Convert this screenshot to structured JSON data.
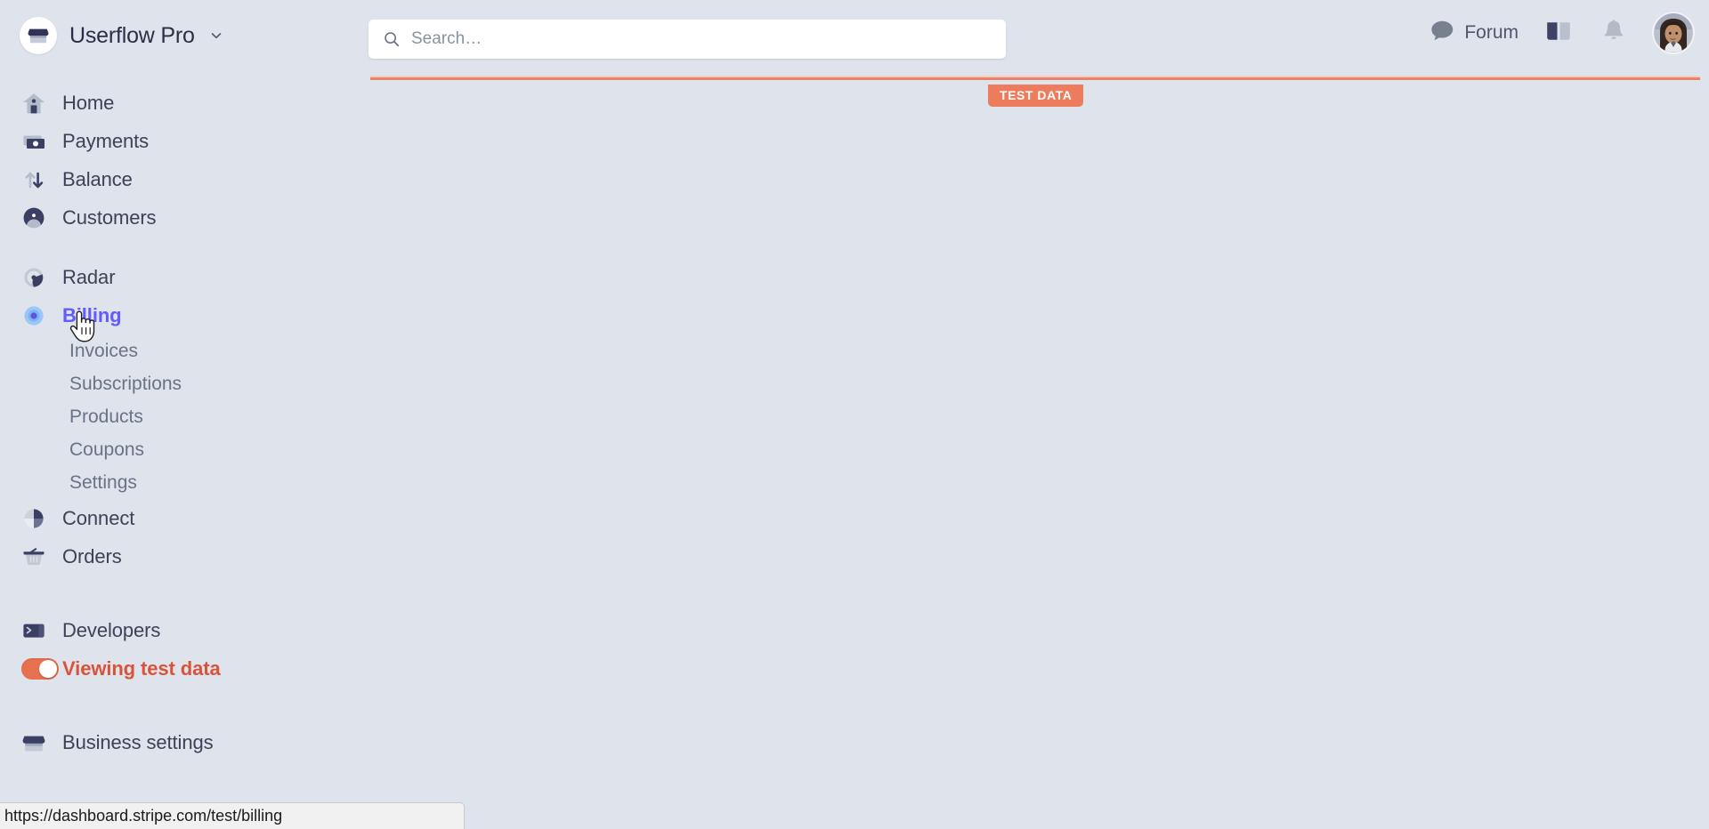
{
  "header": {
    "brand": {
      "name": "Userflow Pro",
      "logo_icon": "store-icon",
      "caret_icon": "chevron-down-icon"
    },
    "search": {
      "placeholder": "Search…",
      "value": "",
      "icon": "search-icon"
    },
    "forum": {
      "label": "Forum",
      "icon": "speech-bubble-icon"
    },
    "docs": {
      "icon": "book-icon"
    },
    "notifications": {
      "icon": "bell-icon"
    },
    "account": {
      "icon": "avatar"
    }
  },
  "test_banner": {
    "badge_label": "TEST DATA",
    "line_color": "#e8836a",
    "badge_color": "#ed7c5c"
  },
  "sidebar": {
    "items": [
      {
        "label": "Home",
        "icon": "home-icon",
        "name": "home"
      },
      {
        "label": "Payments",
        "icon": "payments-icon",
        "name": "payments"
      },
      {
        "label": "Balance",
        "icon": "balance-icon",
        "name": "balance"
      },
      {
        "label": "Customers",
        "icon": "customers-icon",
        "name": "customers"
      },
      {
        "label": "Radar",
        "icon": "radar-icon",
        "name": "radar"
      },
      {
        "label": "Billing",
        "icon": "billing-icon",
        "name": "billing",
        "active": true
      },
      {
        "label": "Connect",
        "icon": "connect-icon",
        "name": "connect"
      },
      {
        "label": "Orders",
        "icon": "orders-icon",
        "name": "orders"
      },
      {
        "label": "Developers",
        "icon": "terminal-icon",
        "name": "developers"
      },
      {
        "label": "Viewing test data",
        "icon": "toggle-on",
        "name": "viewing-test-data"
      },
      {
        "label": "Business settings",
        "icon": "store-icon",
        "name": "business-settings"
      }
    ],
    "billing_subitems": [
      {
        "label": "Invoices",
        "name": "invoices"
      },
      {
        "label": "Subscriptions",
        "name": "subscriptions"
      },
      {
        "label": "Products",
        "name": "products"
      },
      {
        "label": "Coupons",
        "name": "coupons"
      },
      {
        "label": "Settings",
        "name": "settings"
      }
    ],
    "active_color": "#635bff",
    "test_data_color": "#d9533a"
  },
  "status_bar": {
    "url": "https://dashboard.stripe.com/test/billing"
  }
}
